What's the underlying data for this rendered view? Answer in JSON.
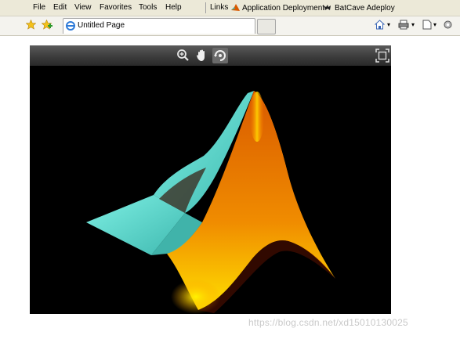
{
  "menu": [
    {
      "label": "File"
    },
    {
      "label": "Edit"
    },
    {
      "label": "View"
    },
    {
      "label": "Favorites"
    },
    {
      "label": "Tools"
    },
    {
      "label": "Help"
    }
  ],
  "links": {
    "label": "Links",
    "items": [
      {
        "label": "Application Deployment",
        "icon": "matlab-logo-icon"
      },
      {
        "label": "BatCave Adeploy",
        "icon": "bat-icon"
      }
    ]
  },
  "tab": {
    "title": "Untitled Page",
    "icon": "ie-page-icon"
  },
  "viewer_toolbar": {
    "tools": [
      {
        "icon": "zoom-in-icon"
      },
      {
        "icon": "pan-hand-icon"
      },
      {
        "icon": "rotate-3d-icon",
        "active": true
      }
    ],
    "fullscreen_icon": "fullscreen-icon"
  },
  "plot": {
    "subject": "3-D surface (MATLAB membrane logo)",
    "colors": [
      "#5fd8cc",
      "#e37a00",
      "#ffd000",
      "#7a1a00"
    ]
  },
  "watermark": "https://blog.csdn.net/xd15010130025"
}
